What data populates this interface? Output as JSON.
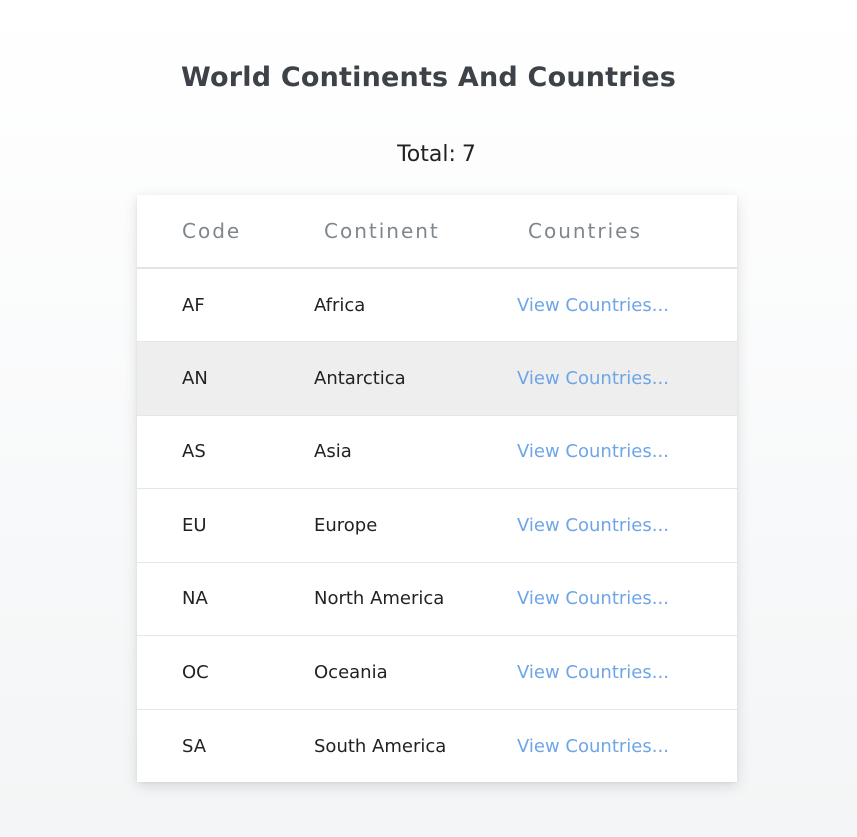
{
  "page": {
    "title": "World Continents And Countries",
    "total_label": "Total:",
    "total_value": "7"
  },
  "table": {
    "headers": {
      "code": "Code",
      "continent": "Continent",
      "countries": "Countries"
    },
    "rows": [
      {
        "code": "AF",
        "continent": "Africa",
        "link": "View Countries..."
      },
      {
        "code": "AN",
        "continent": "Antarctica",
        "link": "View Countries..."
      },
      {
        "code": "AS",
        "continent": "Asia",
        "link": "View Countries..."
      },
      {
        "code": "EU",
        "continent": "Europe",
        "link": "View Countries..."
      },
      {
        "code": "NA",
        "continent": "North America",
        "link": "View Countries..."
      },
      {
        "code": "OC",
        "continent": "Oceania",
        "link": "View Countries..."
      },
      {
        "code": "SA",
        "continent": "South America",
        "link": "View Countries..."
      }
    ]
  },
  "colors": {
    "link": "#6ea5e6",
    "row_hover": "#eeeeee",
    "title": "#3d4148",
    "header_text": "#7f878c"
  }
}
